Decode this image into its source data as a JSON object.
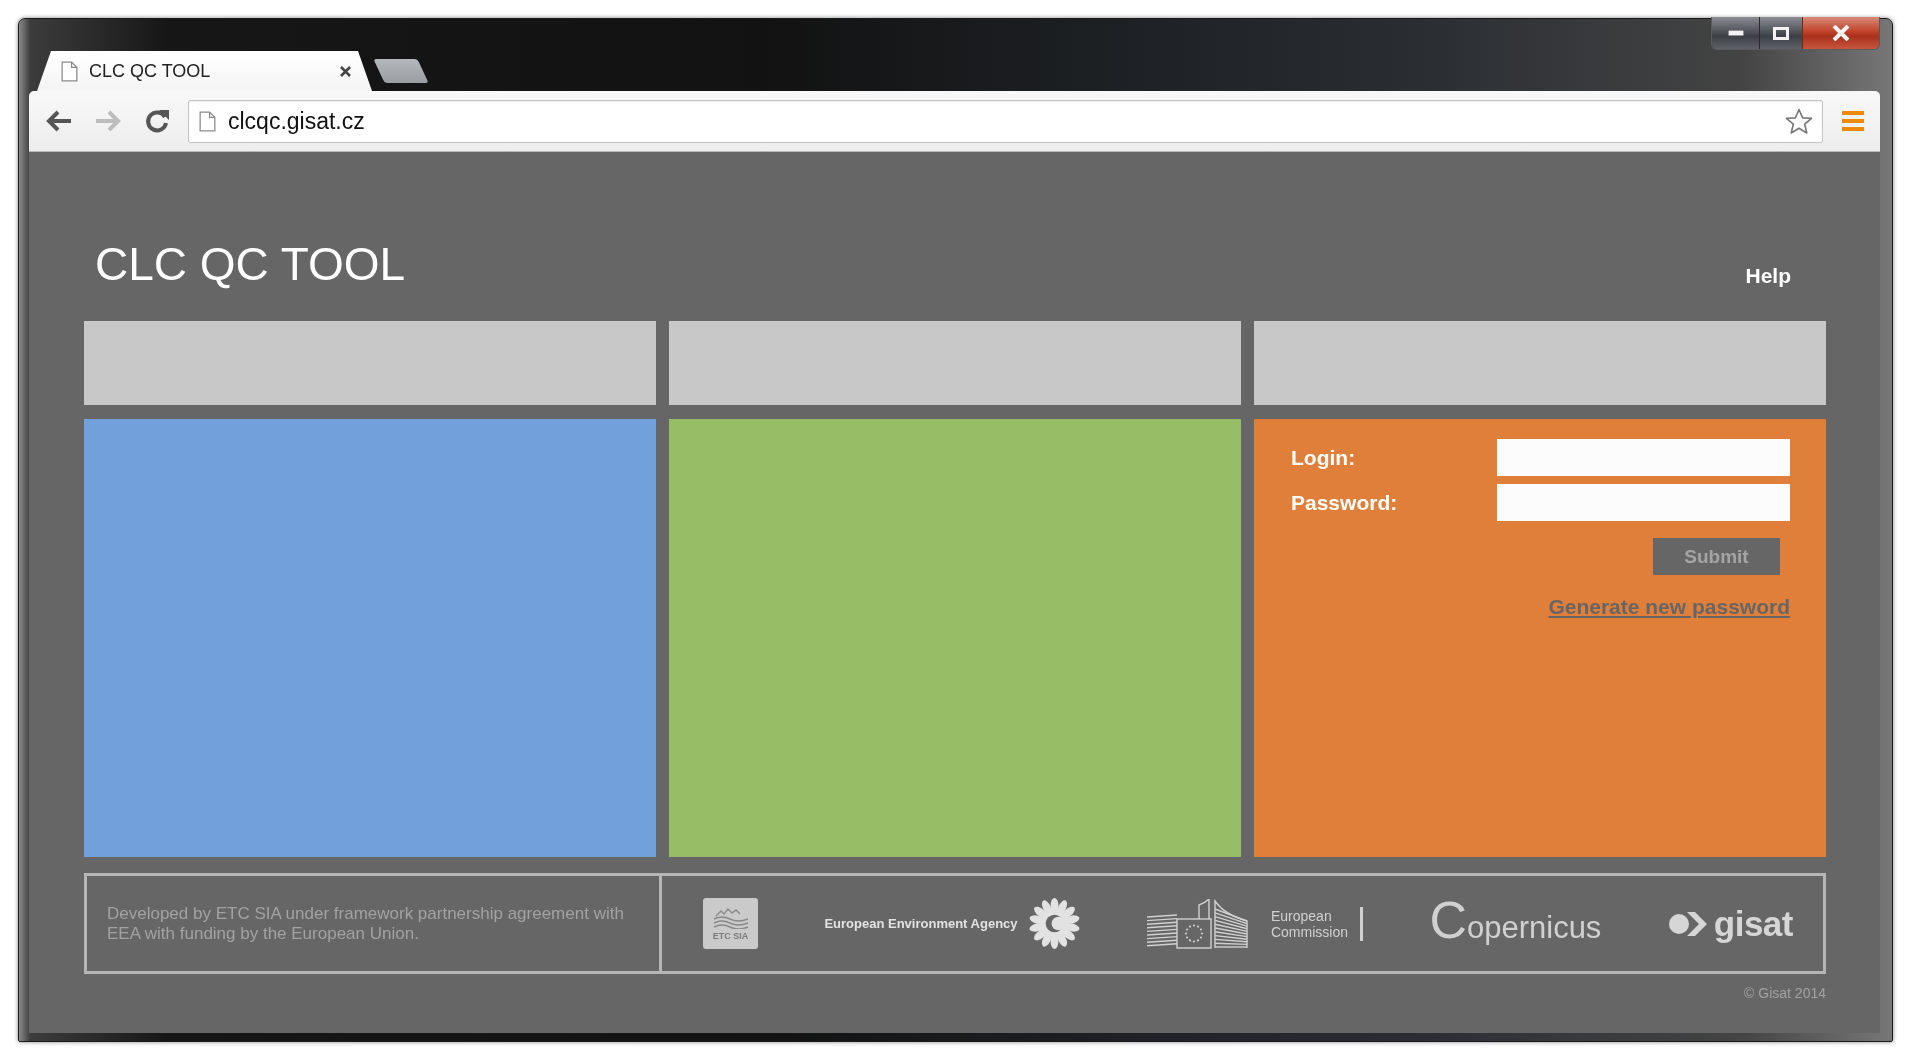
{
  "browser": {
    "tabs": [
      {
        "title": "CLC QC TOOL",
        "selected": true
      }
    ],
    "nav_buttons": [
      {
        "kind": "back",
        "disabled": false
      },
      {
        "kind": "forward",
        "disabled": true
      },
      {
        "kind": "reload",
        "disabled": false
      }
    ],
    "url": "clcqc.gisat.cz"
  },
  "page": {
    "title": "CLC QC TOOL",
    "help_link": "Help",
    "panels": [
      {
        "kind": "blank",
        "color": "#72a0da"
      },
      {
        "kind": "blank",
        "color": "#97bd67"
      },
      {
        "kind": "login",
        "color": "#e07f39",
        "form": {
          "fields": [
            {
              "label": "Login:"
            },
            {
              "label": "Password:"
            }
          ],
          "submit": {
            "label": "Submit",
            "disabled": true
          },
          "link": "Generate new password"
        }
      }
    ],
    "footer": {
      "credit": "Developed by ETC SIA under framework partnership agreement with EEA with funding by the European Union.",
      "logos": [
        {
          "kind": "etc-sia",
          "label": "ETC SIA"
        },
        {
          "kind": "eea",
          "label": "European Environment Agency"
        },
        {
          "kind": "ec",
          "label": "European Commission"
        },
        {
          "kind": "copernicus",
          "label": "Copernicus"
        },
        {
          "kind": "gisat",
          "label": "gisat"
        }
      ]
    },
    "copyright": "© Gisat 2014"
  }
}
